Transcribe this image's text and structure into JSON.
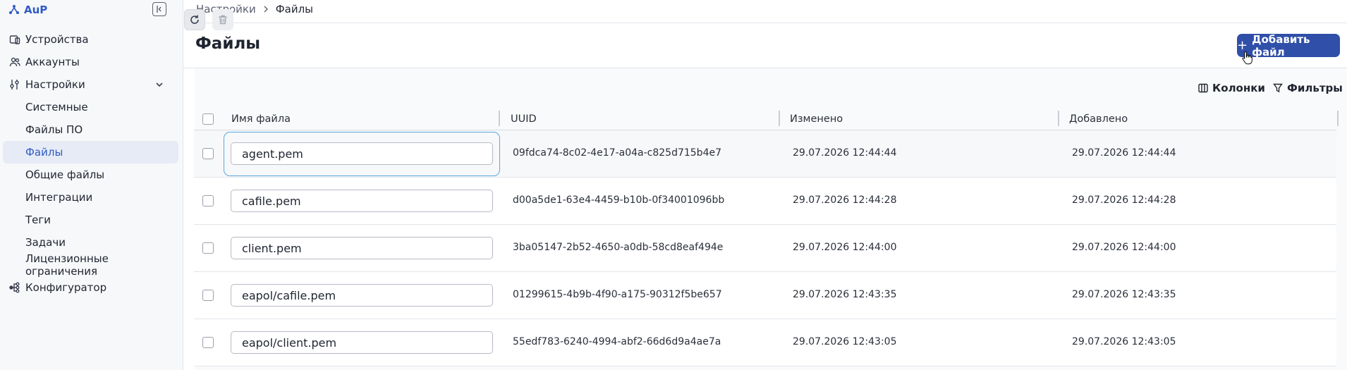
{
  "brand": {
    "name": "AuP"
  },
  "sidebar": {
    "items": [
      {
        "label": "Устройства",
        "icon": "devices-icon"
      },
      {
        "label": "Аккаунты",
        "icon": "users-icon"
      },
      {
        "label": "Настройки",
        "icon": "settings-sliders-icon",
        "expanded": true
      }
    ],
    "settings_children": [
      {
        "label": "Системные"
      },
      {
        "label": "Файлы ПО"
      },
      {
        "label": "Файлы",
        "active": true
      },
      {
        "label": "Общие файлы"
      },
      {
        "label": "Интеграции"
      },
      {
        "label": "Теги"
      },
      {
        "label": "Задачи"
      },
      {
        "label": "Лицензионные ограничения"
      }
    ],
    "after": [
      {
        "label": "Конфигуратор",
        "icon": "configurator-icon"
      }
    ]
  },
  "breadcrumb": {
    "parent": "Настройки",
    "current": "Файлы"
  },
  "page": {
    "title": "Файлы",
    "add_button": "Добавить файл"
  },
  "toolbar": {
    "columns_label": "Колонки",
    "filters_label": "Фильтры"
  },
  "table": {
    "headers": {
      "name": "Имя файла",
      "uuid": "UUID",
      "changed": "Изменено",
      "added": "Добавлено"
    },
    "rows": [
      {
        "name": "agent.pem",
        "uuid": "09fdca74-8c02-4e17-a04a-c825d715b4e7",
        "changed": "29.07.2026 12:44:44",
        "added": "29.07.2026 12:44:44",
        "focused": true
      },
      {
        "name": "cafile.pem",
        "uuid": "d00a5de1-63e4-4459-b10b-0f34001096bb",
        "changed": "29.07.2026 12:44:28",
        "added": "29.07.2026 12:44:28"
      },
      {
        "name": "client.pem",
        "uuid": "3ba05147-2b52-4650-a0db-58cd8eaf494e",
        "changed": "29.07.2026 12:44:00",
        "added": "29.07.2026 12:44:00"
      },
      {
        "name": "eapol/cafile.pem",
        "uuid": "01299615-4b9b-4f90-a175-90312f5be657",
        "changed": "29.07.2026 12:43:35",
        "added": "29.07.2026 12:43:35"
      },
      {
        "name": "eapol/client.pem",
        "uuid": "55edf783-6240-4994-abf2-66d6d9a4ae7a",
        "changed": "29.07.2026 12:43:05",
        "added": "29.07.2026 12:43:05"
      }
    ]
  },
  "colors": {
    "accent": "#2f5bc4",
    "primary_button": "#2f4fa8",
    "focus": "#5aa8dc"
  }
}
